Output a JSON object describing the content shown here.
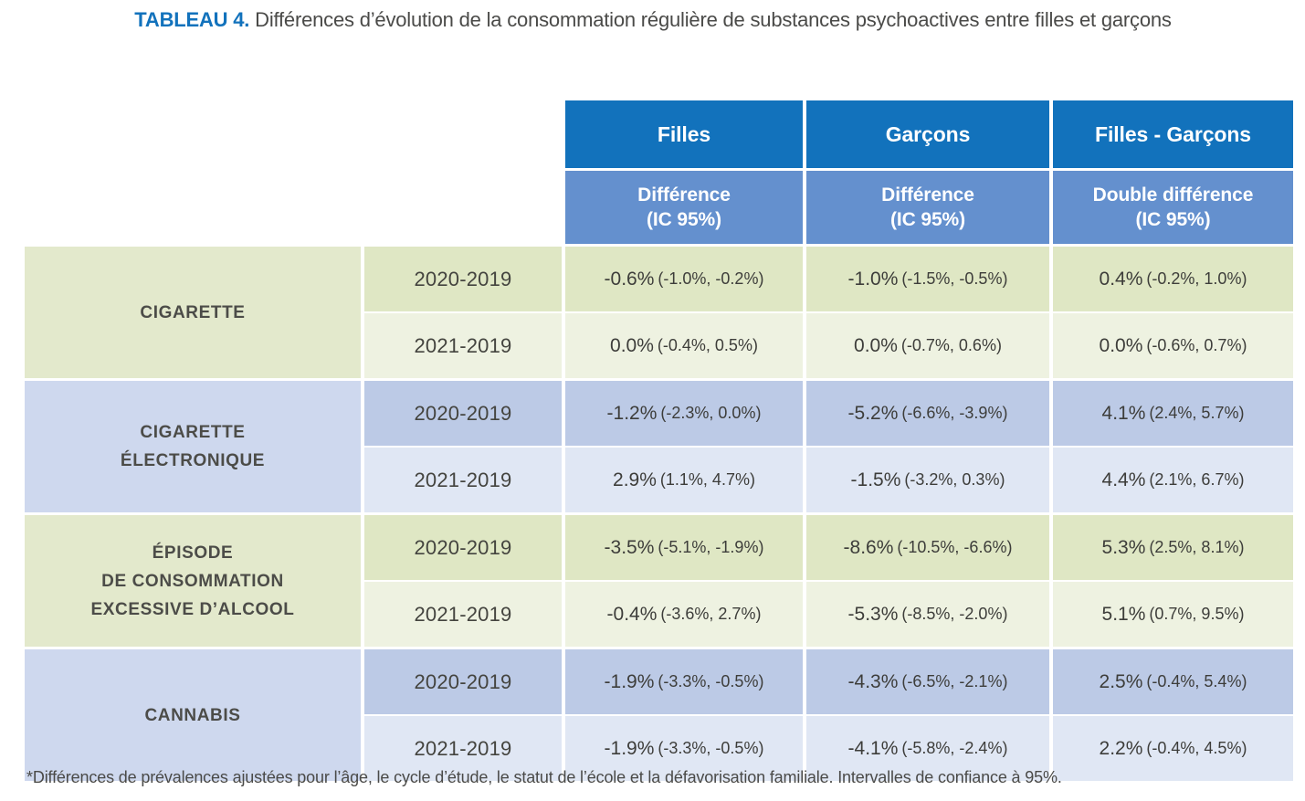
{
  "title": {
    "tag": "TABLEAU 4.",
    "text": " Différences d’évolution de la consommation régulière de substances psychoactives entre filles et garçons"
  },
  "colors": {
    "header_dark_blue": "#1272BC",
    "header_light_blue": "#6490CE",
    "green_dark": "#DFE7C4",
    "green_light": "#EEF2E1",
    "green_label": "#E3E9CC",
    "blue_dark": "#BCCAE6",
    "blue_light": "#E0E7F4",
    "blue_label": "#CED8EE",
    "text_dark": "#4a4a48"
  },
  "header": {
    "top": [
      "Filles",
      "Garçons",
      "Filles - Garçons"
    ],
    "sub": [
      {
        "line1": "Différence",
        "line2": "(IC 95%)"
      },
      {
        "line1": "Différence",
        "line2": "(IC 95%)"
      },
      {
        "line1": "Double différence",
        "line2": "(IC 95%)"
      }
    ]
  },
  "sections": [
    {
      "label_lines": [
        "CIGARETTE"
      ],
      "theme": "green",
      "rows": [
        {
          "year": "2020-2019",
          "filles_main": "-0.6%",
          "filles_ci": "(-1.0%, -0.2%)",
          "garcons_main": "-1.0%",
          "garcons_ci": "(-1.5%, -0.5%)",
          "diff_main": "0.4%",
          "diff_ci": "(-0.2%, 1.0%)"
        },
        {
          "year": "2021-2019",
          "filles_main": "0.0%",
          "filles_ci": "(-0.4%, 0.5%)",
          "garcons_main": "0.0%",
          "garcons_ci": "(-0.7%, 0.6%)",
          "diff_main": "0.0%",
          "diff_ci": "(-0.6%, 0.7%)"
        }
      ]
    },
    {
      "label_lines": [
        "CIGARETTE",
        "ÉLECTRONIQUE"
      ],
      "theme": "blue",
      "rows": [
        {
          "year": "2020-2019",
          "filles_main": "-1.2%",
          "filles_ci": "(-2.3%, 0.0%)",
          "garcons_main": "-5.2%",
          "garcons_ci": "(-6.6%, -3.9%)",
          "diff_main": "4.1%",
          "diff_ci": "(2.4%, 5.7%)"
        },
        {
          "year": "2021-2019",
          "filles_main": "2.9%",
          "filles_ci": "(1.1%, 4.7%)",
          "garcons_main": "-1.5%",
          "garcons_ci": "(-3.2%, 0.3%)",
          "diff_main": "4.4%",
          "diff_ci": "(2.1%, 6.7%)"
        }
      ]
    },
    {
      "label_lines": [
        "ÉPISODE",
        "DE CONSOMMATION",
        "EXCESSIVE D’ALCOOL"
      ],
      "theme": "green",
      "rows": [
        {
          "year": "2020-2019",
          "filles_main": "-3.5%",
          "filles_ci": "(-5.1%, -1.9%)",
          "garcons_main": "-8.6%",
          "garcons_ci": "(-10.5%, -6.6%)",
          "diff_main": "5.3%",
          "diff_ci": "(2.5%, 8.1%)"
        },
        {
          "year": "2021-2019",
          "filles_main": "-0.4%",
          "filles_ci": "(-3.6%, 2.7%)",
          "garcons_main": "-5.3%",
          "garcons_ci": "(-8.5%, -2.0%)",
          "diff_main": "5.1%",
          "diff_ci": "(0.7%, 9.5%)"
        }
      ]
    },
    {
      "label_lines": [
        "CANNABIS"
      ],
      "theme": "blue",
      "rows": [
        {
          "year": "2020-2019",
          "filles_main": "-1.9%",
          "filles_ci": "(-3.3%, -0.5%)",
          "garcons_main": "-4.3%",
          "garcons_ci": "(-6.5%, -2.1%)",
          "diff_main": "2.5%",
          "diff_ci": "(-0.4%, 5.4%)"
        },
        {
          "year": "2021-2019",
          "filles_main": "-1.9%",
          "filles_ci": "(-3.3%, -0.5%)",
          "garcons_main": "-4.1%",
          "garcons_ci": "(-5.8%, -2.4%)",
          "diff_main": "2.2%",
          "diff_ci": "(-0.4%, 4.5%)"
        }
      ]
    }
  ],
  "footnote": "*Différences de prévalences ajustées pour l’âge, le cycle d’étude, le statut de l’école et la défavorisation familiale. Intervalles de confiance à 95%."
}
